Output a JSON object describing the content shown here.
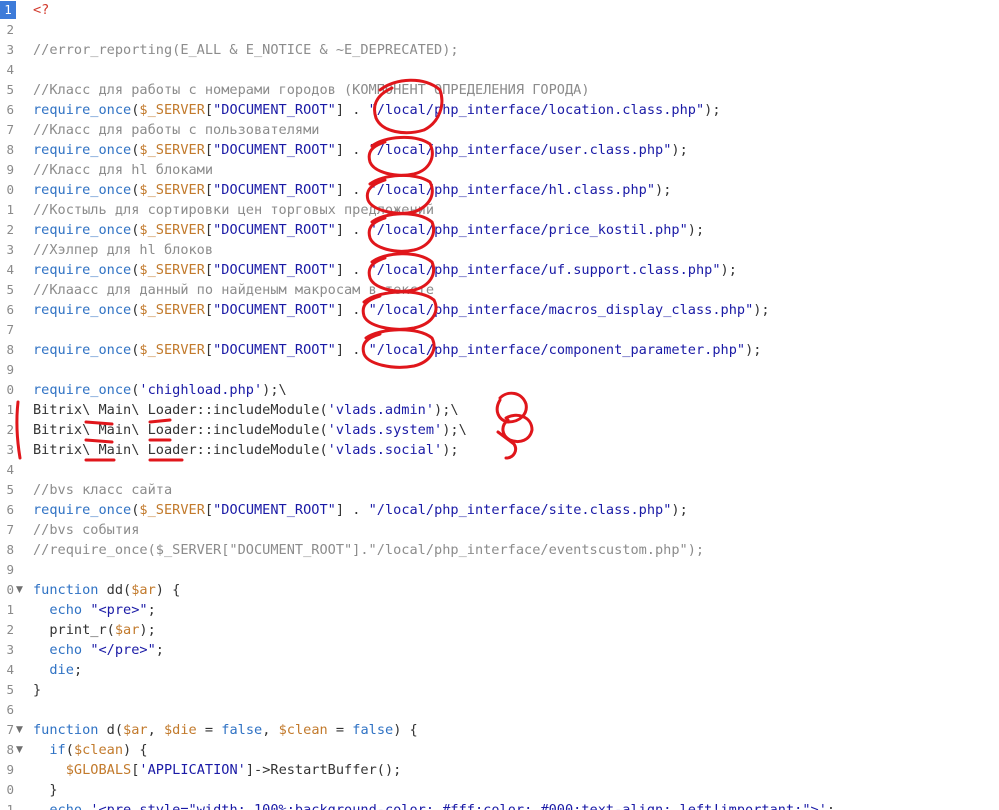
{
  "editor": {
    "active_line": "1",
    "lines": [
      {
        "n": "1",
        "parts": [
          {
            "t": "<?",
            "c": "red"
          }
        ]
      },
      {
        "n": "2",
        "parts": []
      },
      {
        "n": "3",
        "parts": [
          {
            "t": "//error_reporting(E_ALL & E_NOTICE & ~E_DEPRECATED);",
            "c": "cmt"
          }
        ]
      },
      {
        "n": "4",
        "parts": []
      },
      {
        "n": "5",
        "parts": [
          {
            "t": "//Класс для работы с номерами городов (КОМПОНЕНТ ОПРЕДЕЛЕНИЯ ГОРОДА)",
            "c": "cmt"
          }
        ]
      },
      {
        "n": "6",
        "parts": [
          {
            "t": "require_once",
            "c": "fn"
          },
          {
            "t": "(",
            "c": "pun"
          },
          {
            "t": "$_SERVER",
            "c": "var"
          },
          {
            "t": "[",
            "c": "pun"
          },
          {
            "t": "\"DOCUMENT_ROOT\"",
            "c": "str"
          },
          {
            "t": "] . ",
            "c": "pun"
          },
          {
            "t": "\"/local/php_interface/location.class.php\"",
            "c": "str"
          },
          {
            "t": ");",
            "c": "pun"
          }
        ]
      },
      {
        "n": "7",
        "parts": [
          {
            "t": "//Класс для работы с пользователями",
            "c": "cmt"
          }
        ]
      },
      {
        "n": "8",
        "parts": [
          {
            "t": "require_once",
            "c": "fn"
          },
          {
            "t": "(",
            "c": "pun"
          },
          {
            "t": "$_SERVER",
            "c": "var"
          },
          {
            "t": "[",
            "c": "pun"
          },
          {
            "t": "\"DOCUMENT_ROOT\"",
            "c": "str"
          },
          {
            "t": "] . ",
            "c": "pun"
          },
          {
            "t": "\"/local/php_interface/user.class.php\"",
            "c": "str"
          },
          {
            "t": ");",
            "c": "pun"
          }
        ]
      },
      {
        "n": "9",
        "parts": [
          {
            "t": "//Класс для hl блоками",
            "c": "cmt"
          }
        ]
      },
      {
        "n": "0",
        "parts": [
          {
            "t": "require_once",
            "c": "fn"
          },
          {
            "t": "(",
            "c": "pun"
          },
          {
            "t": "$_SERVER",
            "c": "var"
          },
          {
            "t": "[",
            "c": "pun"
          },
          {
            "t": "\"DOCUMENT_ROOT\"",
            "c": "str"
          },
          {
            "t": "] . ",
            "c": "pun"
          },
          {
            "t": "\"/local/php_interface/hl.class.php\"",
            "c": "str"
          },
          {
            "t": ");",
            "c": "pun"
          }
        ]
      },
      {
        "n": "1",
        "parts": [
          {
            "t": "//Костыль для сортировки цен торговых предложений",
            "c": "cmt"
          }
        ]
      },
      {
        "n": "2",
        "parts": [
          {
            "t": "require_once",
            "c": "fn"
          },
          {
            "t": "(",
            "c": "pun"
          },
          {
            "t": "$_SERVER",
            "c": "var"
          },
          {
            "t": "[",
            "c": "pun"
          },
          {
            "t": "\"DOCUMENT_ROOT\"",
            "c": "str"
          },
          {
            "t": "] . ",
            "c": "pun"
          },
          {
            "t": "\"/local/php_interface/price_kostil.php\"",
            "c": "str"
          },
          {
            "t": ");",
            "c": "pun"
          }
        ]
      },
      {
        "n": "3",
        "parts": [
          {
            "t": "//Хэлпер для hl блоков",
            "c": "cmt"
          }
        ]
      },
      {
        "n": "4",
        "parts": [
          {
            "t": "require_once",
            "c": "fn"
          },
          {
            "t": "(",
            "c": "pun"
          },
          {
            "t": "$_SERVER",
            "c": "var"
          },
          {
            "t": "[",
            "c": "pun"
          },
          {
            "t": "\"DOCUMENT_ROOT\"",
            "c": "str"
          },
          {
            "t": "] . ",
            "c": "pun"
          },
          {
            "t": "\"/local/php_interface/uf.support.class.php\"",
            "c": "str"
          },
          {
            "t": ");",
            "c": "pun"
          }
        ]
      },
      {
        "n": "5",
        "parts": [
          {
            "t": "//Клаасс для данный по найденым макросам в тексте",
            "c": "cmt"
          }
        ]
      },
      {
        "n": "6",
        "parts": [
          {
            "t": "require_once",
            "c": "fn"
          },
          {
            "t": "(",
            "c": "pun"
          },
          {
            "t": "$_SERVER",
            "c": "var"
          },
          {
            "t": "[",
            "c": "pun"
          },
          {
            "t": "\"DOCUMENT_ROOT\"",
            "c": "str"
          },
          {
            "t": "] . ",
            "c": "pun"
          },
          {
            "t": "\"/local/php_interface/macros_display_class.php\"",
            "c": "str"
          },
          {
            "t": ");",
            "c": "pun"
          }
        ]
      },
      {
        "n": "7",
        "parts": []
      },
      {
        "n": "8",
        "parts": [
          {
            "t": "require_once",
            "c": "fn"
          },
          {
            "t": "(",
            "c": "pun"
          },
          {
            "t": "$_SERVER",
            "c": "var"
          },
          {
            "t": "[",
            "c": "pun"
          },
          {
            "t": "\"DOCUMENT_ROOT\"",
            "c": "str"
          },
          {
            "t": "] . ",
            "c": "pun"
          },
          {
            "t": "\"/local/php_interface/component_parameter.php\"",
            "c": "str"
          },
          {
            "t": ");",
            "c": "pun"
          }
        ]
      },
      {
        "n": "9",
        "parts": []
      },
      {
        "n": "0",
        "parts": [
          {
            "t": "require_once",
            "c": "fn"
          },
          {
            "t": "(",
            "c": "pun"
          },
          {
            "t": "'chighload.php'",
            "c": "str"
          },
          {
            "t": ");\\",
            "c": "pun"
          }
        ]
      },
      {
        "n": "1",
        "parts": [
          {
            "t": "Bitrix\\ Main\\ Loader::includeModule(",
            "c": "txt"
          },
          {
            "t": "'vlads.admin'",
            "c": "str"
          },
          {
            "t": ");\\",
            "c": "pun"
          }
        ]
      },
      {
        "n": "2",
        "parts": [
          {
            "t": "Bitrix\\ Main\\ Loader::includeModule(",
            "c": "txt"
          },
          {
            "t": "'vlads.system'",
            "c": "str"
          },
          {
            "t": ");\\",
            "c": "pun"
          }
        ]
      },
      {
        "n": "3",
        "parts": [
          {
            "t": "Bitrix\\ Main\\ Loader::includeModule(",
            "c": "txt"
          },
          {
            "t": "'vlads.social'",
            "c": "str"
          },
          {
            "t": ");",
            "c": "pun"
          }
        ]
      },
      {
        "n": "4",
        "parts": []
      },
      {
        "n": "5",
        "parts": [
          {
            "t": "//bvs класс сайта",
            "c": "cmt"
          }
        ]
      },
      {
        "n": "6",
        "parts": [
          {
            "t": "require_once",
            "c": "fn"
          },
          {
            "t": "(",
            "c": "pun"
          },
          {
            "t": "$_SERVER",
            "c": "var"
          },
          {
            "t": "[",
            "c": "pun"
          },
          {
            "t": "\"DOCUMENT_ROOT\"",
            "c": "str"
          },
          {
            "t": "] . ",
            "c": "pun"
          },
          {
            "t": "\"/local/php_interface/site.class.php\"",
            "c": "str"
          },
          {
            "t": ");",
            "c": "pun"
          }
        ]
      },
      {
        "n": "7",
        "parts": [
          {
            "t": "//bvs события",
            "c": "cmt"
          }
        ]
      },
      {
        "n": "8",
        "parts": [
          {
            "t": "//require_once($_SERVER[\"DOCUMENT_ROOT\"].\"/local/php_interface/eventscustom.php\");",
            "c": "cmt"
          }
        ]
      },
      {
        "n": "9",
        "parts": []
      },
      {
        "n": "0",
        "fold": "▼",
        "parts": [
          {
            "t": "function",
            "c": "kw"
          },
          {
            "t": " dd(",
            "c": "txt"
          },
          {
            "t": "$ar",
            "c": "var"
          },
          {
            "t": ") {",
            "c": "pun"
          }
        ]
      },
      {
        "n": "1",
        "parts": [
          {
            "t": "  ",
            "c": "txt"
          },
          {
            "t": "echo",
            "c": "kw"
          },
          {
            "t": " ",
            "c": "txt"
          },
          {
            "t": "\"<pre>\"",
            "c": "str"
          },
          {
            "t": ";",
            "c": "pun"
          }
        ]
      },
      {
        "n": "2",
        "parts": [
          {
            "t": "  print_r(",
            "c": "txt"
          },
          {
            "t": "$ar",
            "c": "var"
          },
          {
            "t": ");",
            "c": "pun"
          }
        ]
      },
      {
        "n": "3",
        "parts": [
          {
            "t": "  ",
            "c": "txt"
          },
          {
            "t": "echo",
            "c": "kw"
          },
          {
            "t": " ",
            "c": "txt"
          },
          {
            "t": "\"</pre>\"",
            "c": "str"
          },
          {
            "t": ";",
            "c": "pun"
          }
        ]
      },
      {
        "n": "4",
        "parts": [
          {
            "t": "  ",
            "c": "txt"
          },
          {
            "t": "die",
            "c": "kw"
          },
          {
            "t": ";",
            "c": "pun"
          }
        ]
      },
      {
        "n": "5",
        "parts": [
          {
            "t": "}",
            "c": "pun"
          }
        ]
      },
      {
        "n": "6",
        "parts": []
      },
      {
        "n": "7",
        "fold": "▼",
        "parts": [
          {
            "t": "function",
            "c": "kw"
          },
          {
            "t": " d(",
            "c": "txt"
          },
          {
            "t": "$ar",
            "c": "var"
          },
          {
            "t": ", ",
            "c": "pun"
          },
          {
            "t": "$die",
            "c": "var"
          },
          {
            "t": " = ",
            "c": "pun"
          },
          {
            "t": "false",
            "c": "kw"
          },
          {
            "t": ", ",
            "c": "pun"
          },
          {
            "t": "$clean",
            "c": "var"
          },
          {
            "t": " = ",
            "c": "pun"
          },
          {
            "t": "false",
            "c": "kw"
          },
          {
            "t": ") {",
            "c": "pun"
          }
        ]
      },
      {
        "n": "8",
        "fold": "▼",
        "parts": [
          {
            "t": "  ",
            "c": "txt"
          },
          {
            "t": "if",
            "c": "kw"
          },
          {
            "t": "(",
            "c": "pun"
          },
          {
            "t": "$clean",
            "c": "var"
          },
          {
            "t": ") {",
            "c": "pun"
          }
        ]
      },
      {
        "n": "9",
        "parts": [
          {
            "t": "    ",
            "c": "txt"
          },
          {
            "t": "$GLOBALS",
            "c": "var"
          },
          {
            "t": "[",
            "c": "pun"
          },
          {
            "t": "'APPLICATION'",
            "c": "str"
          },
          {
            "t": "]->RestartBuffer();",
            "c": "pun"
          }
        ]
      },
      {
        "n": "0",
        "parts": [
          {
            "t": "  }",
            "c": "pun"
          }
        ]
      },
      {
        "n": "1",
        "parts": [
          {
            "t": "  ",
            "c": "txt"
          },
          {
            "t": "echo",
            "c": "kw"
          },
          {
            "t": " ",
            "c": "txt"
          },
          {
            "t": "'<pre style=\"width: 100%;background-color: #fff;color: #000;text-align: left!important;\">'",
            "c": "str"
          },
          {
            "t": ";",
            "c": "pun"
          }
        ]
      }
    ]
  }
}
